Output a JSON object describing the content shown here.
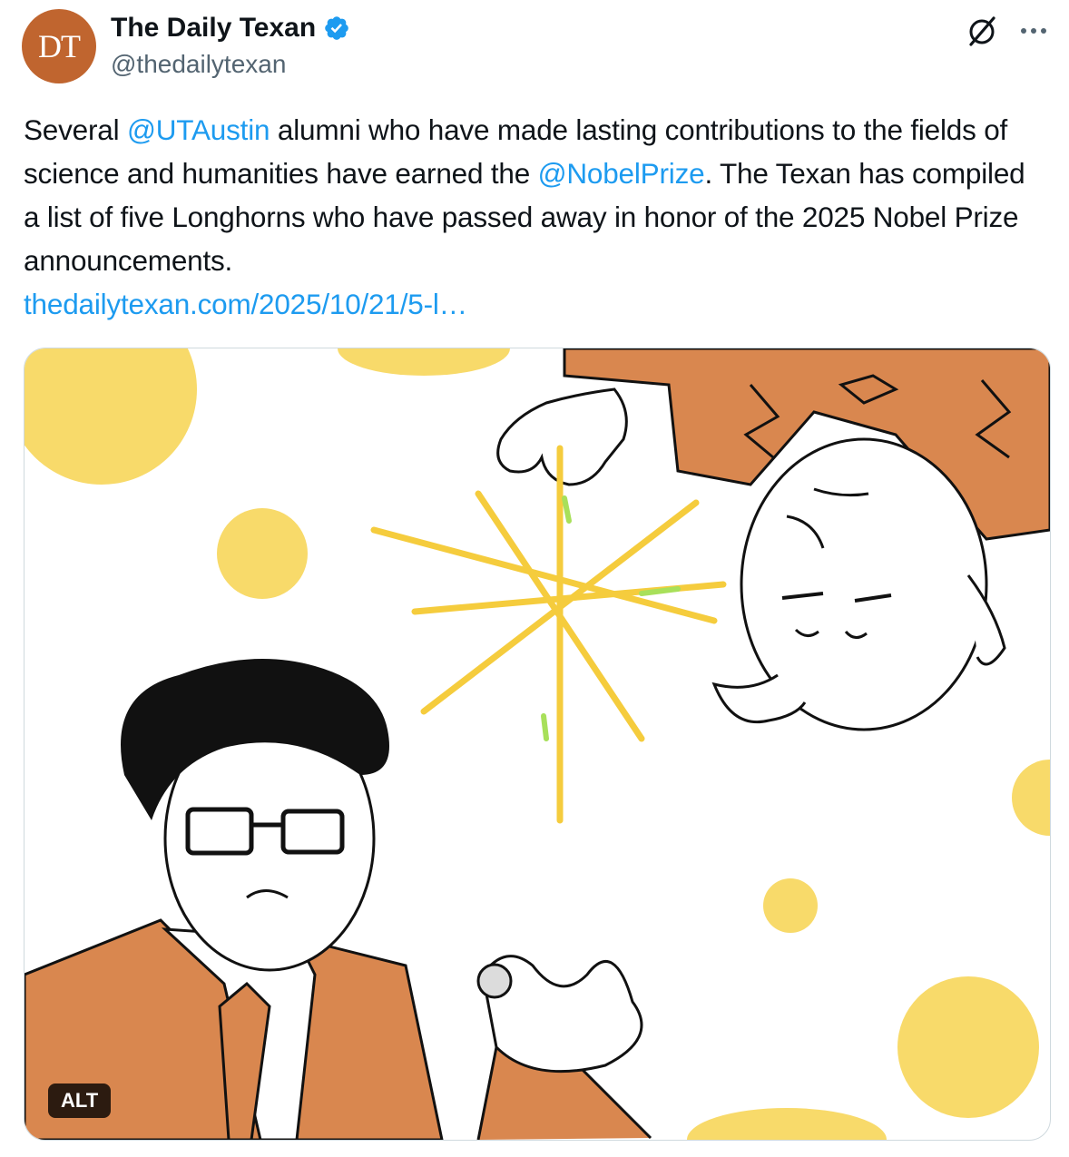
{
  "author": {
    "avatar_text": "DT",
    "display_name": "The Daily Texan",
    "handle": "@thedailytexan",
    "verified": true,
    "avatar_color": "#c0652f"
  },
  "actions": {
    "grok_icon": "grok-icon",
    "more_icon": "more-icon"
  },
  "tweet": {
    "segments": {
      "s1": "Several ",
      "mention1": "@UTAustin",
      "s2": " alumni who have made lasting contributions to the fields of science and humanities have earned the ",
      "mention2": "@NobelPrize",
      "s3": ". The Texan has compiled a list of five Longhorns who have passed away in honor of the 2025 Nobel Prize announcements.",
      "link": "thedailytexan.com/2025/10/21/5-l…"
    },
    "link_color": "#1d9bf0"
  },
  "media": {
    "alt_label": "ALT",
    "palette": {
      "orange": "#d9874f",
      "yellow": "#f8da6a",
      "star": "#f5cc3d",
      "green": "#a8e05a"
    }
  }
}
